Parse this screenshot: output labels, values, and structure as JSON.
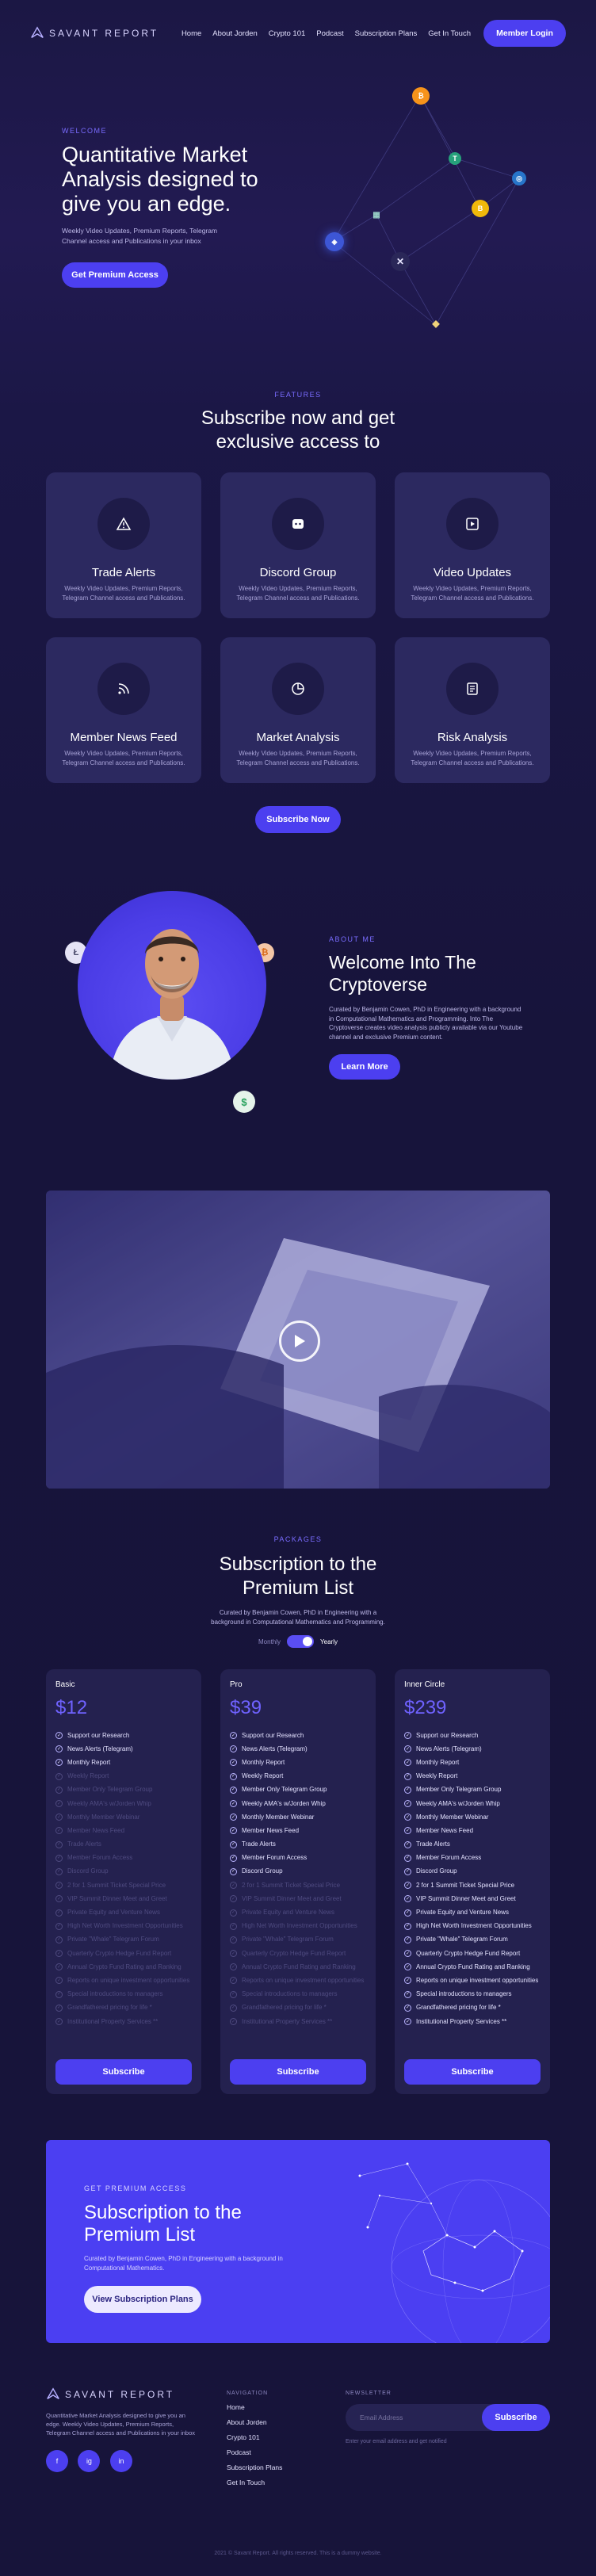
{
  "brand": {
    "name": "SAVANT REPORT",
    "accent": "#4c3ff0"
  },
  "nav": {
    "items": [
      "Home",
      "About Jorden",
      "Crypto 101",
      "Podcast",
      "Subscription Plans",
      "Get In Touch"
    ],
    "cta": "Member Login"
  },
  "hero": {
    "eyebrow": "WELCOME",
    "title": "Quantitative Market Analysis designed to give you an edge.",
    "text": "Weekly Video Updates, Premium Reports, Telegram Channel access and Publications in your inbox",
    "button": "Get Premium Access"
  },
  "features": {
    "eyebrow": "FEATURES",
    "title": "Subscribe now and get exclusive access to",
    "cards": [
      {
        "title": "Trade Alerts",
        "text": "Weekly Video Updates, Premium Reports, Telegram Channel access and Publications.",
        "icon": "warning-icon"
      },
      {
        "title": "Discord Group",
        "text": "Weekly Video Updates, Premium Reports, Telegram Channel access and Publications.",
        "icon": "discord-icon"
      },
      {
        "title": "Video Updates",
        "text": "Weekly Video Updates, Premium Reports, Telegram Channel access and Publications.",
        "icon": "play-square-icon"
      },
      {
        "title": "Member News Feed",
        "text": "Weekly Video Updates, Premium Reports, Telegram Channel access and Publications.",
        "icon": "rss-icon"
      },
      {
        "title": "Market Analysis",
        "text": "Weekly Video Updates, Premium Reports, Telegram Channel access and Publications.",
        "icon": "pie-chart-icon"
      },
      {
        "title": "Risk Analysis",
        "text": "Weekly Video Updates, Premium Reports, Telegram Channel access and Publications.",
        "icon": "report-icon"
      }
    ],
    "button": "Subscribe Now"
  },
  "about": {
    "eyebrow": "ABOUT ME",
    "title": "Welcome Into The Cryptoverse",
    "text": "Curated by Benjamin Cowen, PhD in Engineering with a background in Computational Mathematics and Programming. Into The Cryptoverse creates video analysis publicly available via our Youtube channel and exclusive Premium content.",
    "button": "Learn More"
  },
  "pricing": {
    "eyebrow": "PACKAGES",
    "title": "Subscription to the Premium List",
    "text": "Curated by Benjamin Cowen, PhD in Engineering with a background in Computational Mathematics and Programming.",
    "toggle": {
      "monthly": "Monthly",
      "yearly": "Yearly",
      "selected": "Yearly"
    },
    "features": [
      "Support our Research",
      "News Alerts (Telegram)",
      "Monthly Report",
      "Weekly Report",
      "Member Only Telegram Group",
      "Weekly AMA's w/Jorden Whip",
      "Monthly Member Webinar",
      "Member News Feed",
      "Trade Alerts",
      "Member Forum Access",
      "Discord Group",
      "2 for 1 Summit Ticket Special Price",
      "VIP Summit Dinner Meet and Greet",
      "Private Equity and Venture News",
      "High Net Worth Investment Opportunities",
      "Private \"Whale\" Telegram Forum",
      "Quarterly Crypto Hedge Fund Report",
      "Annual Crypto Fund Rating and Ranking",
      "Reports on unique investment opportunities",
      "Special introductions to managers",
      "Grandfathered pricing for life *",
      "Institutional Property Services **"
    ],
    "plans": [
      {
        "name": "Basic",
        "price": "$12",
        "included": 3,
        "button": "Subscribe"
      },
      {
        "name": "Pro",
        "price": "$39",
        "included": 11,
        "button": "Subscribe"
      },
      {
        "name": "Inner Circle",
        "price": "$239",
        "included": 22,
        "button": "Subscribe"
      }
    ]
  },
  "cta": {
    "eyebrow": "GET PREMIUM ACCESS",
    "title": "Subscription to the Premium List",
    "text": "Curated by Benjamin Cowen, PhD in Engineering with a background in Computational Mathematics.",
    "button": "View Subscription Plans"
  },
  "footer": {
    "about": "Quantitative Market Analysis designed to give you an edge. Weekly Video Updates, Premium Reports, Telegram Channel access and Publications in your inbox",
    "social": [
      "f",
      "ig",
      "in"
    ],
    "nav_head": "NAVIGATION",
    "nav": [
      "Home",
      "About Jorden",
      "Crypto 101",
      "Podcast",
      "Subscription Plans",
      "Get In Touch"
    ],
    "newsletter_head": "NEWSLETTER",
    "email_placeholder": "Email Address",
    "subscribe": "Subscribe",
    "newsletter_note": "Enter your email address and get notified",
    "copyright": "2021 © Savant Report. All rights reserved. This is a dummy website."
  }
}
